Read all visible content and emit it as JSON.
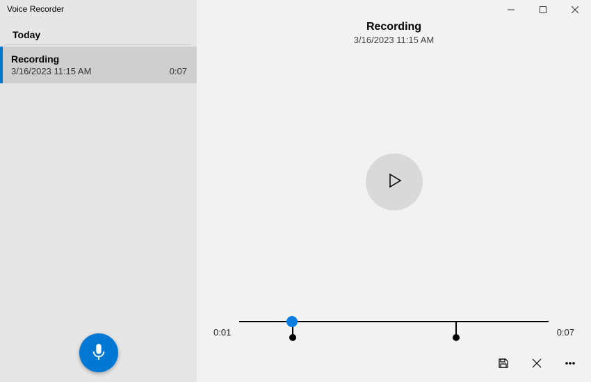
{
  "app": {
    "title": "Voice Recorder"
  },
  "sidebar": {
    "section": "Today",
    "items": [
      {
        "title": "Recording",
        "datetime": "3/16/2023 11:15 AM",
        "duration": "0:07",
        "selected": true
      }
    ]
  },
  "main": {
    "title": "Recording",
    "datetime": "3/16/2023 11:15 AM",
    "playback": {
      "currentTime": "0:01",
      "totalTime": "0:07",
      "progressPercent": 17,
      "markers": [
        17,
        70
      ]
    }
  },
  "colors": {
    "accent": "#0078d4"
  }
}
